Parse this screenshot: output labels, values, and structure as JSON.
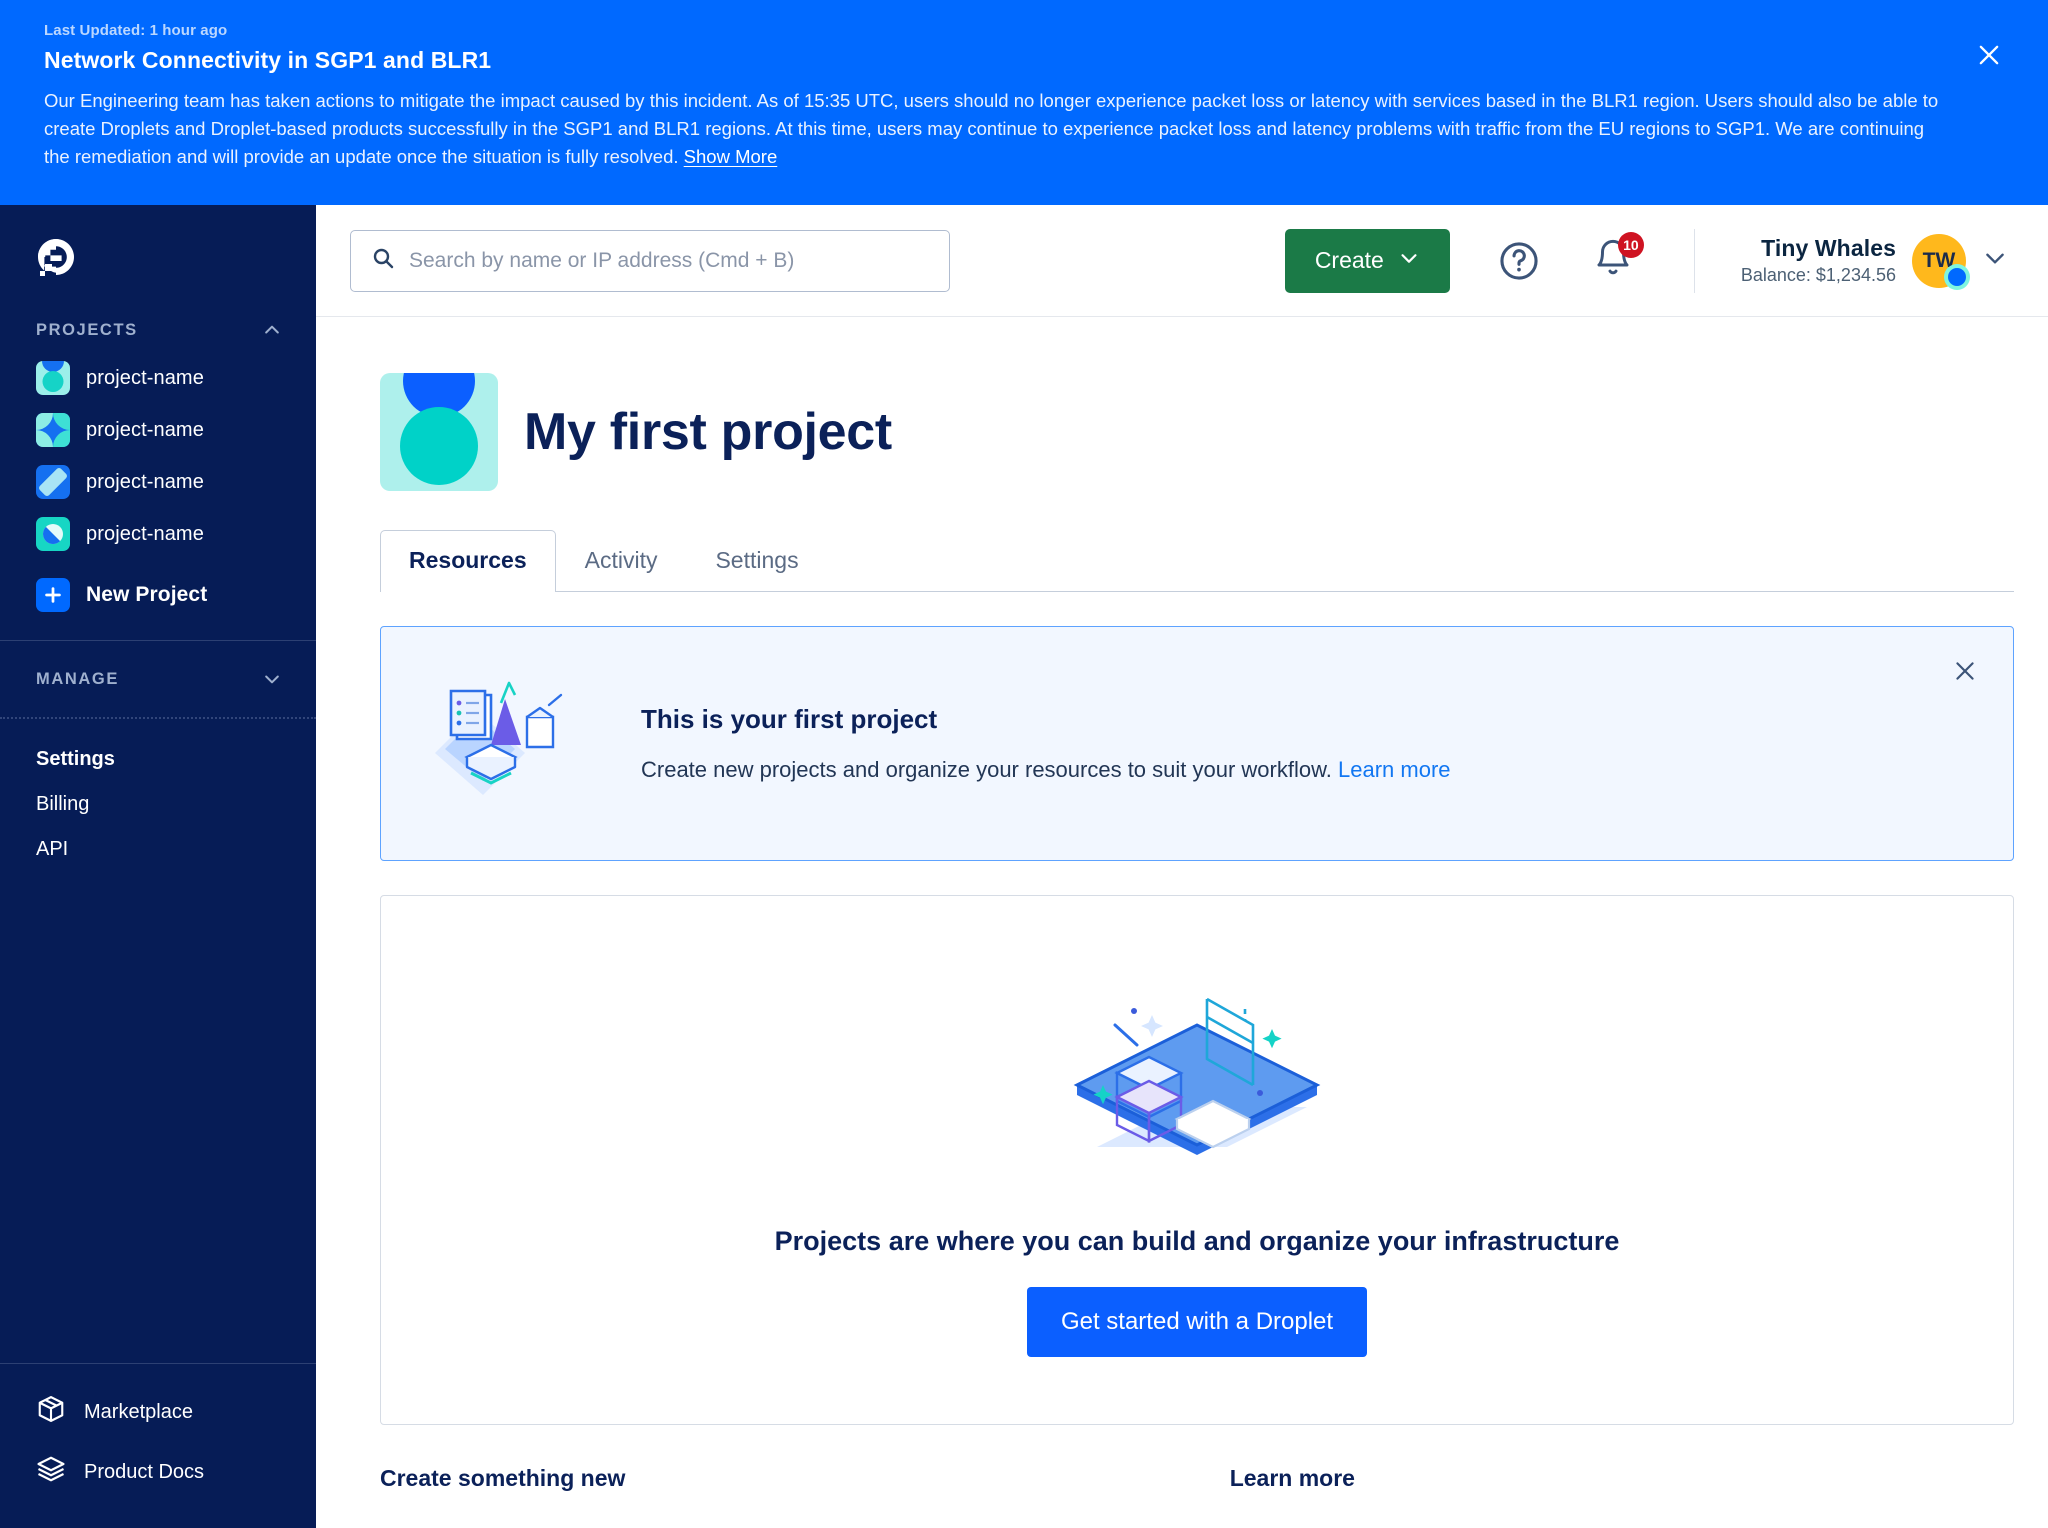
{
  "incident": {
    "last_updated": "Last Updated: 1 hour ago",
    "title": "Network Connectivity in SGP1 and BLR1",
    "body": "Our Engineering team has taken actions to mitigate the impact caused by this incident. As of 15:35 UTC, users should no longer experience packet loss or latency with services based in the BLR1 region. Users should also be able to create Droplets and Droplet-based products successfully in the SGP1 and BLR1 regions. At this time, users may continue to experience packet loss and latency problems with traffic from the EU regions to SGP1. We are continuing the remediation and will provide an update once the situation is fully resolved.",
    "show_more": "Show More",
    "background_color": "#0069FF",
    "close_icon": "close-icon"
  },
  "sidebar": {
    "logo": "digitalocean-logo",
    "background_color": "#061C56",
    "projects_section": {
      "label": "PROJECTS",
      "collapse_icon": "chevron-up-icon",
      "items": [
        {
          "label": "project-name",
          "icon": "project-avatar-icon"
        },
        {
          "label": "project-name",
          "icon": "project-avatar-icon"
        },
        {
          "label": "project-name",
          "icon": "project-avatar-icon"
        },
        {
          "label": "project-name",
          "icon": "project-avatar-icon"
        }
      ],
      "new_project": {
        "label": "New Project",
        "icon": "plus-icon"
      }
    },
    "manage_section": {
      "label": "MANAGE",
      "collapse_icon": "chevron-down-icon",
      "items": [
        {
          "label": "Settings",
          "active": true
        },
        {
          "label": "Billing",
          "active": false
        },
        {
          "label": "API",
          "active": false
        }
      ]
    },
    "footer_items": [
      {
        "label": "Marketplace",
        "icon": "cube-icon"
      },
      {
        "label": "Product Docs",
        "icon": "stack-icon"
      }
    ]
  },
  "topbar": {
    "search": {
      "placeholder": "Search by name or IP address (Cmd + B)",
      "value": "",
      "icon": "search-icon"
    },
    "create_button": {
      "label": "Create",
      "icon": "chevron-down-icon",
      "color": "#1B7A47"
    },
    "help_icon": "help-circle-icon",
    "notifications": {
      "icon": "bell-icon",
      "count": "10",
      "badge_color": "#CF1322"
    },
    "user": {
      "name": "Tiny Whales",
      "balance": "Balance: $1,234.56",
      "avatar_initials": "TW",
      "avatar_color": "#FFB81C",
      "chevron": "chevron-down-icon"
    }
  },
  "project": {
    "title": "My first project",
    "avatar_icon": "project-avatar-icon",
    "tabs": [
      {
        "label": "Resources",
        "active": true
      },
      {
        "label": "Activity",
        "active": false
      },
      {
        "label": "Settings",
        "active": false
      }
    ]
  },
  "first_project_banner": {
    "title": "This is your first project",
    "description": "Create new projects and organize your resources to suit your workflow.",
    "link": "Learn more",
    "illustration": "project-illustration",
    "close_icon": "close-icon",
    "accent_color": "#5EA3FF",
    "background_color": "#F2F7FF"
  },
  "empty_state": {
    "illustration": "infrastructure-illustration",
    "title": "Projects are where you can build and organize your infrastructure",
    "button": {
      "label": "Get started with a Droplet",
      "color": "#0B5FFF"
    }
  },
  "bottom": {
    "create_heading": "Create something new",
    "learn_heading": "Learn more"
  }
}
